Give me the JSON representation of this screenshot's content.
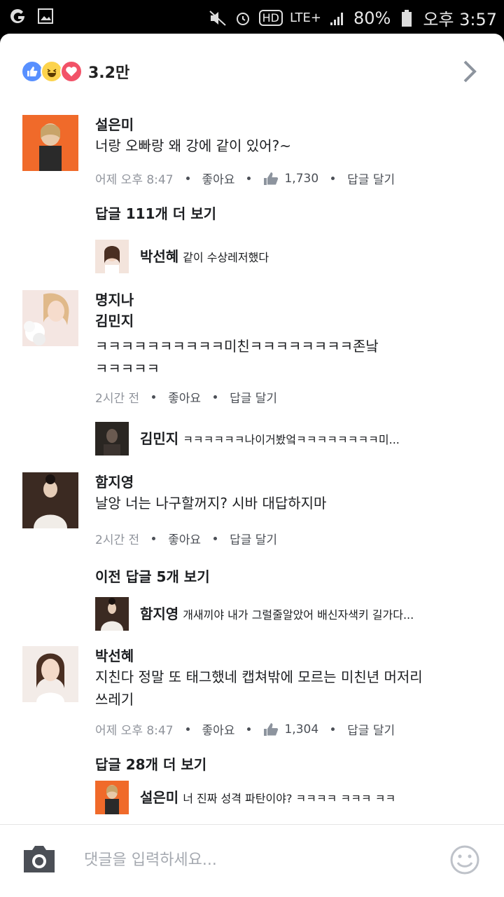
{
  "status_bar": {
    "battery": "80%",
    "time": "오후 3:57",
    "network": "LTE+",
    "hd": "HD"
  },
  "reactions": {
    "count": "3.2만"
  },
  "comments": [
    {
      "name": "설은미",
      "text": "너랑 오빠랑 왜 강에 같이 있어?~",
      "time": "어제 오후 8:47",
      "like_label": "좋아요",
      "likes": "1,730",
      "reply_label": "답글 달기",
      "more_replies": "답글 111개 더 보기",
      "reply": {
        "name": "박선혜",
        "text": "같이 수상레저했다"
      }
    },
    {
      "name": "명지나",
      "text_line1": "김민지",
      "text_line2": "ㅋㅋㅋㅋㅋㅋㅋㅋㅋㅋ미친ㅋㅋㅋㅋㅋㅋㅋㅋ존낰",
      "text_line3": "ㅋㅋㅋㅋㅋ",
      "time": "2시간 전",
      "like_label": "좋아요",
      "reply_label": "답글 달기",
      "reply": {
        "name": "김민지",
        "text": "ㅋㅋㅋㅋㅋㅋ나이거봤엌ㅋㅋㅋㅋㅋㅋㅋㅋ미..."
      }
    },
    {
      "name": "함지영",
      "text": "날앙 너는 나구할꺼지? 시바 대답하지마",
      "time": "2시간 전",
      "like_label": "좋아요",
      "reply_label": "답글 달기",
      "more_replies": "이전 답글 5개 보기",
      "reply": {
        "name": "함지영",
        "text": "개새끼야 내가 그럴줄알았어 배신자색키 길가다..."
      }
    },
    {
      "name": "박선혜",
      "text_line1": "지친다 정말 또 태그했네 캡쳐밖에 모르는 미친년 머저리",
      "text_line2": "쓰레기",
      "time": "어제 오후 8:47",
      "like_label": "좋아요",
      "likes": "1,304",
      "reply_label": "답글 달기",
      "more_replies": "답글 28개 더 보기",
      "reply": {
        "name": "설은미",
        "text": "너 진짜 성격 파탄이야? ㅋㅋㅋㅋ ㅋㅋㅋ ㅋㅋ"
      }
    }
  ],
  "composer": {
    "placeholder": "댓글을 입력하세요..."
  },
  "colors": {
    "like_blue": "#5890ff",
    "haha_yellow": "#fcd34d",
    "love_red": "#f25268",
    "meta_gray": "#90949c"
  }
}
